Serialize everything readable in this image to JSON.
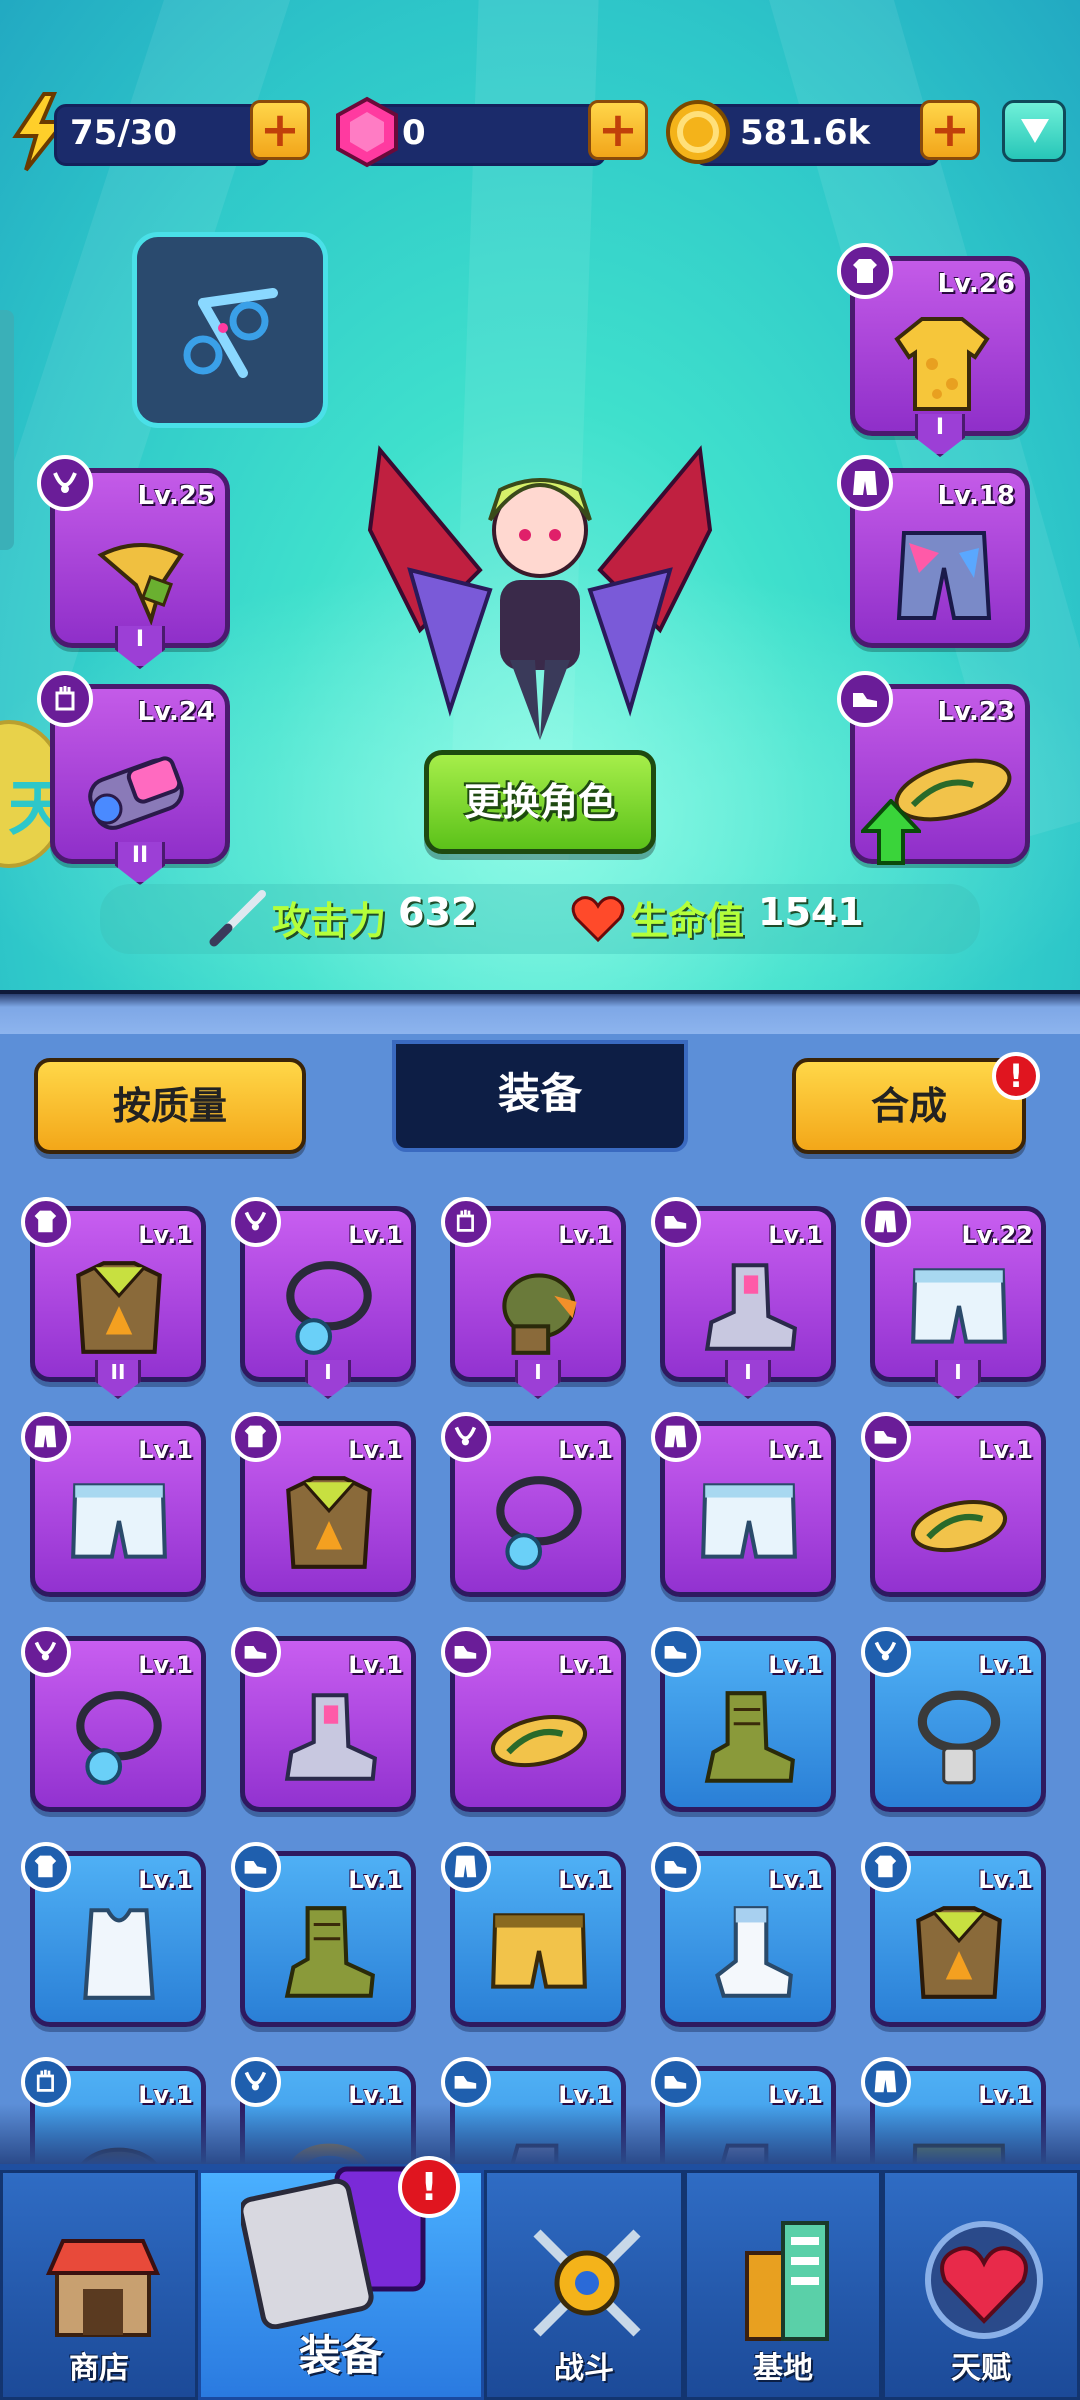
{
  "resources": {
    "energy": "75/30",
    "gems": "0",
    "coins": "581.6k"
  },
  "character": {
    "change_button": "更换角色",
    "attack_label": "攻击力",
    "attack_value": "632",
    "hp_label": "生命值",
    "hp_value": "1541"
  },
  "equipped": {
    "necklace": {
      "level": "Lv.25",
      "rank": "I"
    },
    "gloves": {
      "level": "Lv.24",
      "rank": "II"
    },
    "shirt": {
      "level": "Lv.26",
      "rank": "I"
    },
    "pants": {
      "level": "Lv.18"
    },
    "shoes": {
      "level": "Lv.23"
    }
  },
  "inventory_header": {
    "sort_button": "按质量",
    "title": "装备",
    "merge_button": "合成",
    "alert": "!"
  },
  "inventory": [
    {
      "slot": "shirt",
      "item": "armor-vest",
      "quality": "purple",
      "level": "Lv.1",
      "rank": "II"
    },
    {
      "slot": "necklace",
      "item": "pendant-necklace",
      "quality": "purple",
      "level": "Lv.1",
      "rank": "I"
    },
    {
      "slot": "gloves",
      "item": "boxing-glove",
      "quality": "purple",
      "level": "Lv.1",
      "rank": "I"
    },
    {
      "slot": "shoes",
      "item": "tech-boot",
      "quality": "purple",
      "level": "Lv.1",
      "rank": "I"
    },
    {
      "slot": "pants",
      "item": "white-shorts",
      "quality": "purple",
      "level": "Lv.22",
      "rank": "I"
    },
    {
      "slot": "pants",
      "item": "white-shorts",
      "quality": "purple",
      "level": "Lv.1"
    },
    {
      "slot": "shirt",
      "item": "armor-vest",
      "quality": "purple",
      "level": "Lv.1"
    },
    {
      "slot": "necklace",
      "item": "pendant-necklace",
      "quality": "purple",
      "level": "Lv.1"
    },
    {
      "slot": "pants",
      "item": "white-shorts",
      "quality": "purple",
      "level": "Lv.1"
    },
    {
      "slot": "shoes",
      "item": "flip-flop",
      "quality": "purple",
      "level": "Lv.1"
    },
    {
      "slot": "necklace",
      "item": "pendant-necklace",
      "quality": "purple",
      "level": "Lv.1"
    },
    {
      "slot": "shoes",
      "item": "tech-boot",
      "quality": "purple",
      "level": "Lv.1"
    },
    {
      "slot": "shoes",
      "item": "flip-flop",
      "quality": "purple",
      "level": "Lv.1"
    },
    {
      "slot": "shoes",
      "item": "combat-boot",
      "quality": "blue",
      "level": "Lv.1"
    },
    {
      "slot": "necklace",
      "item": "dog-tag-necklace",
      "quality": "blue",
      "level": "Lv.1"
    },
    {
      "slot": "shirt",
      "item": "tank-top",
      "quality": "blue",
      "level": "Lv.1"
    },
    {
      "slot": "shoes",
      "item": "combat-boot",
      "quality": "blue",
      "level": "Lv.1"
    },
    {
      "slot": "pants",
      "item": "yellow-shorts",
      "quality": "blue",
      "level": "Lv.1"
    },
    {
      "slot": "shoes",
      "item": "white-sock",
      "quality": "blue",
      "level": "Lv.1"
    },
    {
      "slot": "shirt",
      "item": "armor-vest",
      "quality": "blue",
      "level": "Lv.1"
    },
    {
      "slot": "gloves",
      "item": "glove",
      "quality": "blue",
      "level": "Lv.1"
    },
    {
      "slot": "necklace",
      "item": "necklace",
      "quality": "blue",
      "level": "Lv.1"
    },
    {
      "slot": "shoes",
      "item": "boot",
      "quality": "blue",
      "level": "Lv.1"
    },
    {
      "slot": "shoes",
      "item": "boot",
      "quality": "blue",
      "level": "Lv.1"
    },
    {
      "slot": "pants",
      "item": "shorts",
      "quality": "blue",
      "level": "Lv.1"
    }
  ],
  "nav": {
    "shop": "商店",
    "equipment": "装备",
    "battle": "战斗",
    "base": "基地",
    "talent": "天赋",
    "equipment_alert": "!"
  },
  "colors": {
    "purple_quality": "#a844e0",
    "blue_quality": "#3b95e6",
    "stat_label": "#b4ff3a",
    "button_yellow": "#f6c230"
  }
}
